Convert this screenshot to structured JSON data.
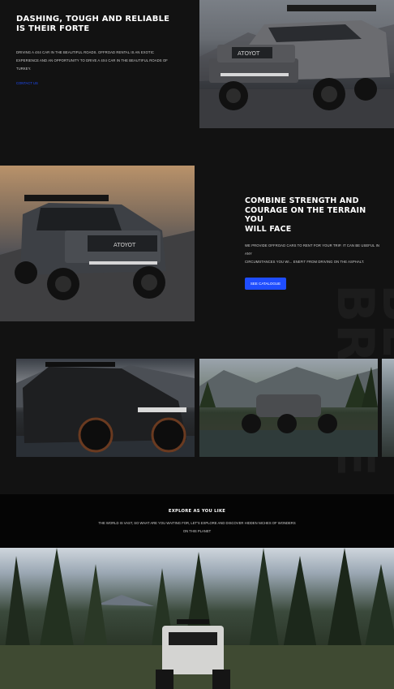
{
  "hero": {
    "title": "DASHING, TOUGH AND RELIABLE IS THEIR FORTE",
    "body_line1": "DRIVING A 4X4 CAR IN THE BEAUTIFUL ROADS. OFFROAD RENTAL IS AN EXOTIC",
    "body_line2": "EXPERIENCE AND AN OPPORTUNITY TO DRIVE A 4X4 CAR IN THE BEAUTIFUL ROADS OF",
    "body_line3": "TURKEY.",
    "link": "CONTACT US",
    "image_alt": "Toyota Tacoma pickup at sunset"
  },
  "feature": {
    "title_line1": "COMBINE STRENGTH AND",
    "title_line2": "COURAGE ON THE TERRAIN YOU",
    "title_line3": "WILL FACE",
    "body_line1": "WE PROVIDE OFFROAD CARS TO RENT FOR YOUR TRIP. IT CAN BE USEFUL IN ANY",
    "body_line2": "CIRCUMSTANCES YOU WI... ENEFIT FROM DRIVING ON THE ASPHALT.",
    "button": "SEE CATALOGUE",
    "image_alt": "Toyota pickup with light bar at dusk"
  },
  "watermark": "BE BRAVE",
  "gallery": {
    "items": [
      "Futuristic black pickup by lake",
      "Offroad buggy by forest lake",
      "Offroad vehicle (partial)"
    ]
  },
  "explore": {
    "title": "EXPLORE AS YOU LIKE",
    "line1": "THE WORLD IS VAST, SO WHAT ARE YOU WAITING FOR, LET'S EXPLORE AND DISCOVER HIDDEN NICHES OF WONDERS",
    "line2": "ON THIS PLANET"
  },
  "banner": {
    "image_alt": "White truck on forest trail"
  },
  "colors": {
    "background": "#121212",
    "accent": "#1f4dff",
    "band": "#050505"
  }
}
